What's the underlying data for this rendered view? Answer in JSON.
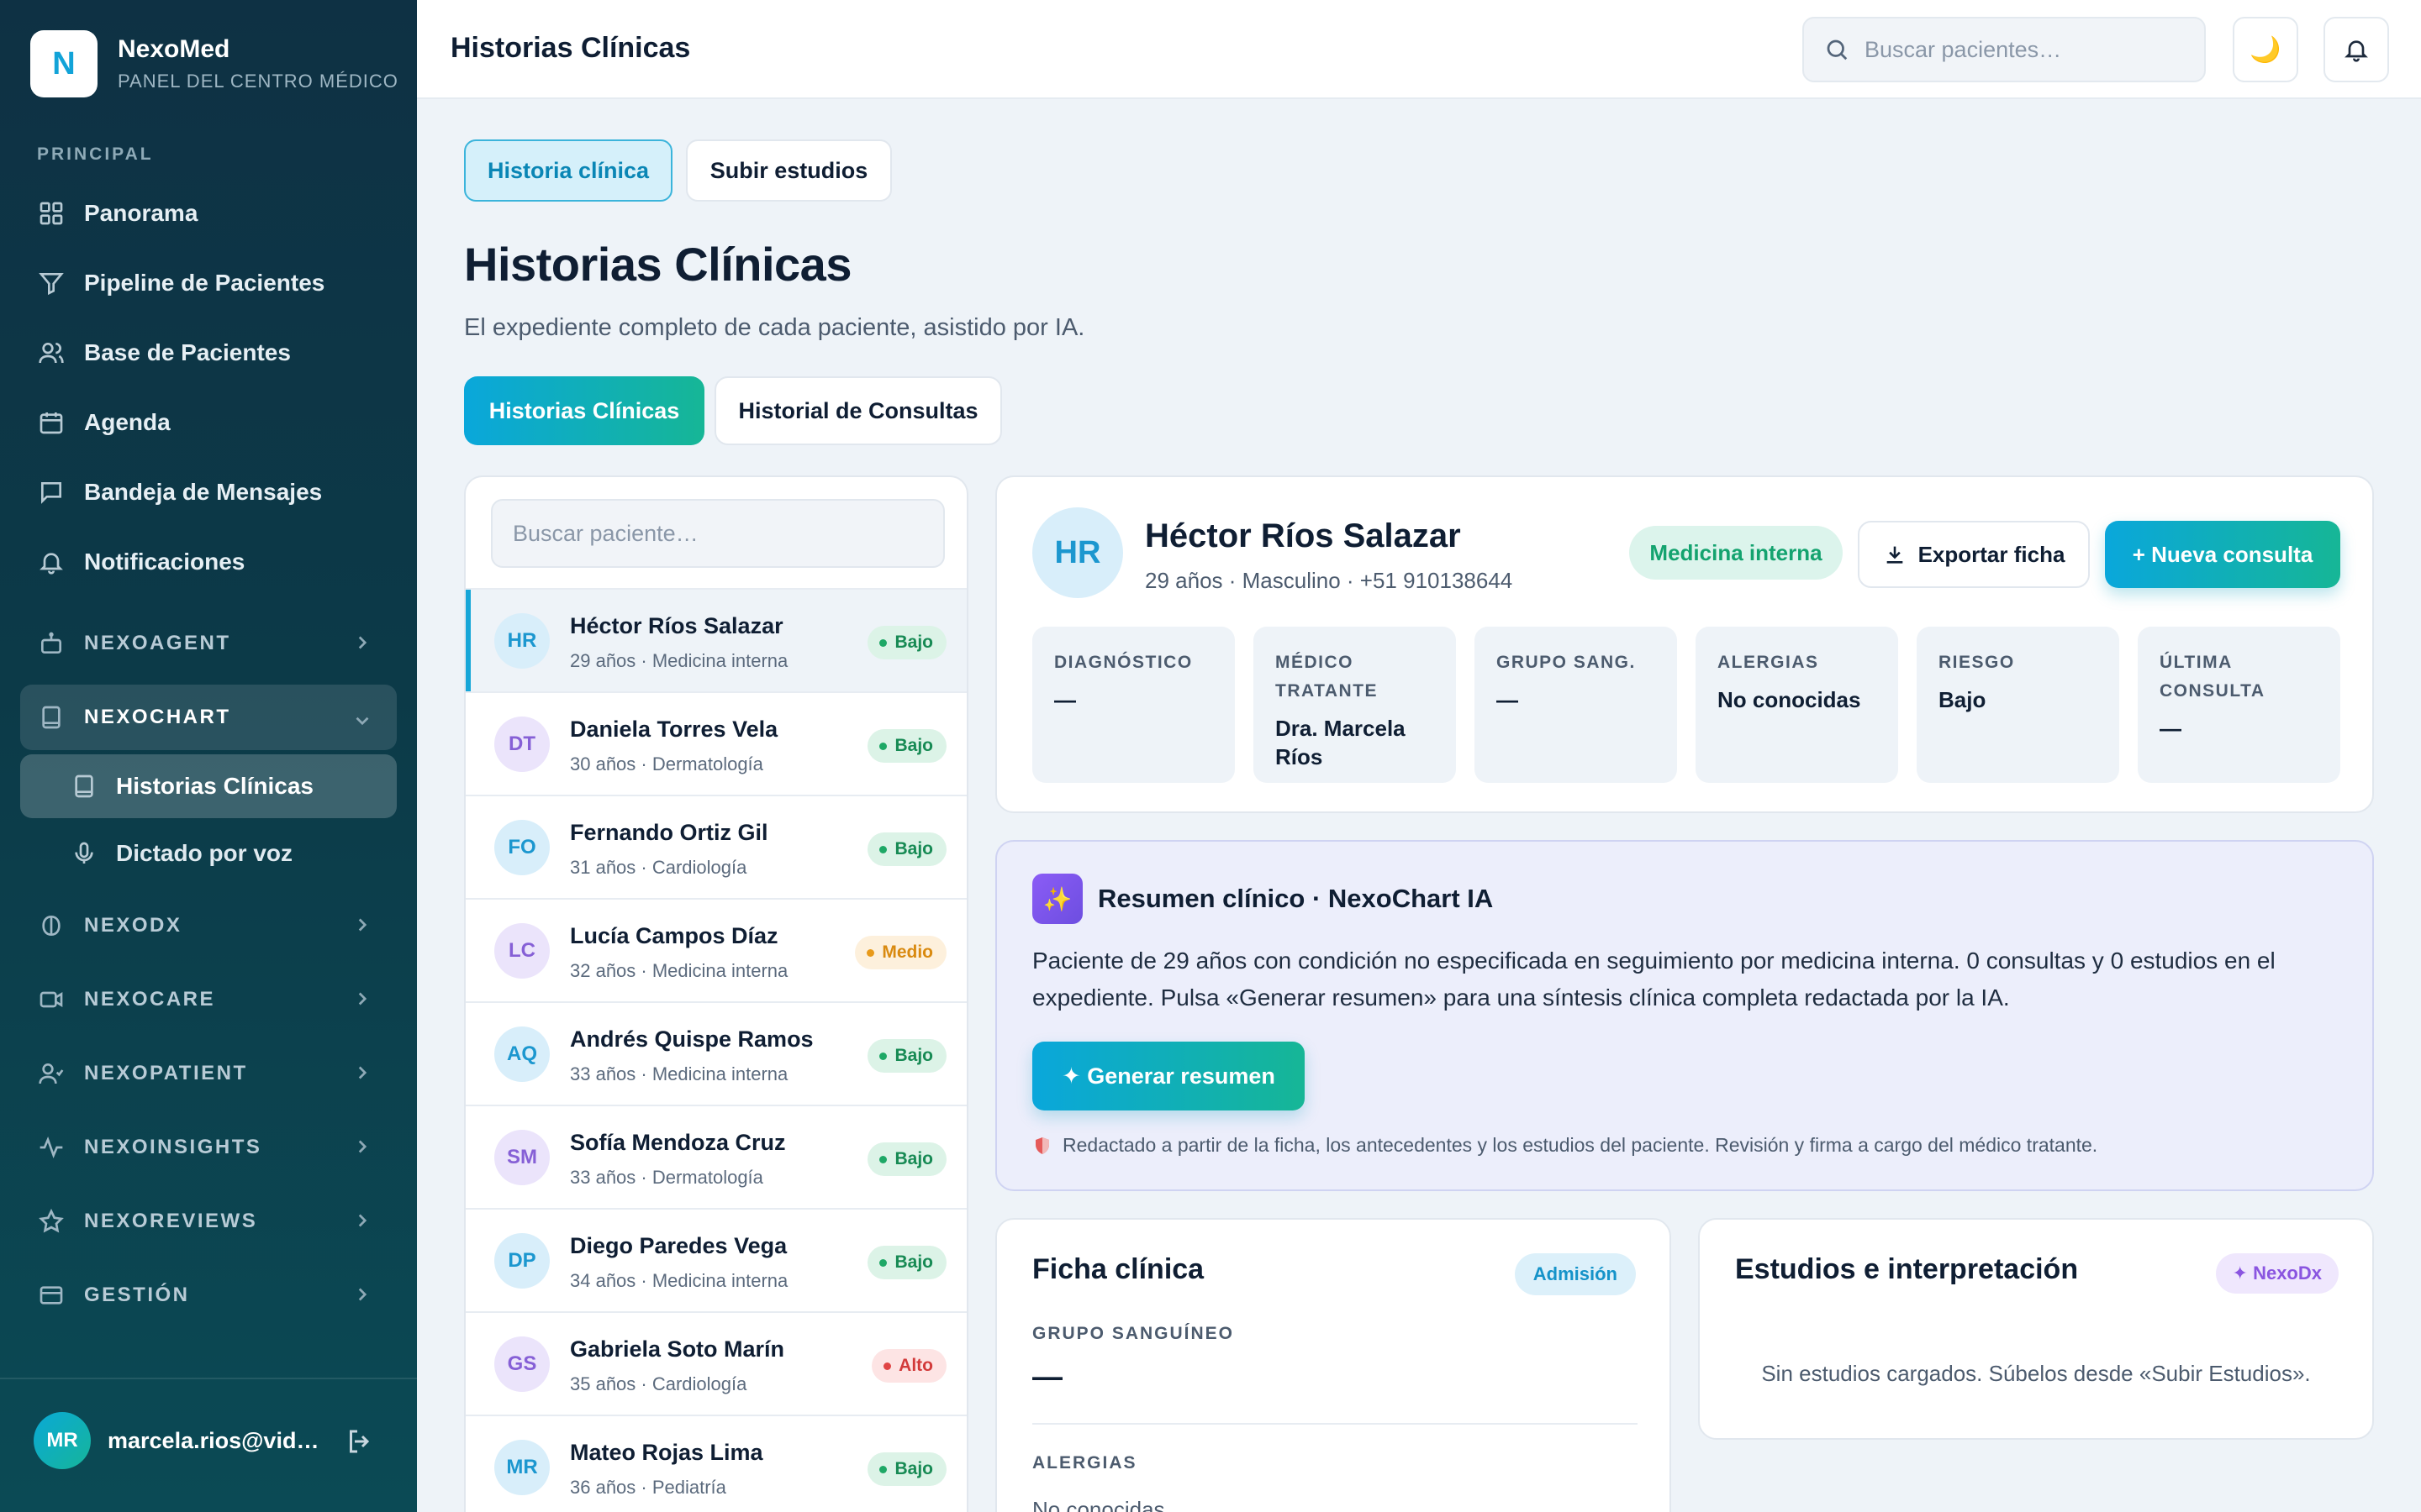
{
  "brand": {
    "logo_letter": "N",
    "name": "NexoMed",
    "subtitle": "PANEL DEL CENTRO MÉDICO"
  },
  "sidebar": {
    "section_label": "PRINCIPAL",
    "items": [
      {
        "label": "Panorama",
        "icon": "grid-icon"
      },
      {
        "label": "Pipeline de Pacientes",
        "icon": "filter-icon"
      },
      {
        "label": "Base de Pacientes",
        "icon": "users-icon"
      },
      {
        "label": "Agenda",
        "icon": "calendar-icon"
      },
      {
        "label": "Bandeja de Mensajes",
        "icon": "message-icon"
      },
      {
        "label": "Notificaciones",
        "icon": "bell-icon"
      }
    ],
    "groups": [
      {
        "label": "NEXOAGENT",
        "icon": "robot-icon"
      },
      {
        "label": "NEXOCHART",
        "icon": "book-icon"
      },
      {
        "label": "NEXODX",
        "icon": "brain-icon"
      },
      {
        "label": "NEXOCARE",
        "icon": "video-icon"
      },
      {
        "label": "NEXOPATIENT",
        "icon": "user-icon"
      },
      {
        "label": "NEXOINSIGHTS",
        "icon": "pulse-icon"
      },
      {
        "label": "NEXOREVIEWS",
        "icon": "star-icon"
      },
      {
        "label": "GESTIÓN",
        "icon": "card-icon"
      }
    ],
    "subitems": [
      {
        "label": "Historias Clínicas",
        "icon": "book-icon"
      },
      {
        "label": "Dictado por voz",
        "icon": "mic-icon"
      }
    ],
    "user": {
      "initials": "MR",
      "email": "marcela.rios@vidasalud.pe"
    }
  },
  "topbar": {
    "title": "Historias Clínicas",
    "search_placeholder": "Buscar pacientes…",
    "theme_icon": "🌙"
  },
  "main": {
    "pills": [
      "Historia clínica",
      "Subir estudios"
    ],
    "title": "Historias Clínicas",
    "subtitle": "El expediente completo de cada paciente, asistido por IA.",
    "tabs": [
      "Historias Clínicas",
      "Historial de Consultas"
    ]
  },
  "patient_list": {
    "search_placeholder": "Buscar paciente…",
    "patients": [
      {
        "initials": "HR",
        "name": "Héctor Ríos Salazar",
        "meta": "29 años · Medicina interna",
        "risk": "Bajo"
      },
      {
        "initials": "DT",
        "name": "Daniela Torres Vela",
        "meta": "30 años · Dermatología",
        "risk": "Bajo"
      },
      {
        "initials": "FO",
        "name": "Fernando Ortiz Gil",
        "meta": "31 años · Cardiología",
        "risk": "Bajo"
      },
      {
        "initials": "LC",
        "name": "Lucía Campos Díaz",
        "meta": "32 años · Medicina interna",
        "risk": "Medio"
      },
      {
        "initials": "AQ",
        "name": "Andrés Quispe Ramos",
        "meta": "33 años · Medicina interna",
        "risk": "Bajo"
      },
      {
        "initials": "SM",
        "name": "Sofía Mendoza Cruz",
        "meta": "33 años · Dermatología",
        "risk": "Bajo"
      },
      {
        "initials": "DP",
        "name": "Diego Paredes Vega",
        "meta": "34 años · Medicina interna",
        "risk": "Bajo"
      },
      {
        "initials": "GS",
        "name": "Gabriela Soto Marín",
        "meta": "35 años · Cardiología",
        "risk": "Alto"
      },
      {
        "initials": "MR",
        "name": "Mateo Rojas Lima",
        "meta": "36 años · Pediatría",
        "risk": "Bajo"
      }
    ]
  },
  "patient": {
    "initials": "HR",
    "name": "Héctor Ríos Salazar",
    "meta": "29 años · Masculino · +51 910138644",
    "specialty": "Medicina interna",
    "export_label": "Exportar ficha",
    "new_consult_label": "+ Nueva consulta",
    "stats": [
      {
        "label": "DIAGNÓSTICO",
        "value": "—"
      },
      {
        "label": "MÉDICO TRATANTE",
        "value": "Dra. Marcela Ríos"
      },
      {
        "label": "GRUPO SANG.",
        "value": "—"
      },
      {
        "label": "ALERGIAS",
        "value": "No conocidas"
      },
      {
        "label": "RIESGO",
        "value": "Bajo"
      },
      {
        "label": "ÚLTIMA CONSULTA",
        "value": "—"
      }
    ]
  },
  "ai_summary": {
    "icon": "✨",
    "title": "Resumen clínico · NexoChart IA",
    "text": "Paciente de 29 años con condición no especificada en seguimiento por medicina interna. 0 consultas y 0 estudios en el expediente. Pulsa «Generar resumen» para una síntesis clínica completa redactada por la IA.",
    "button": "✦ Generar resumen",
    "footnote": "Redactado a partir de la ficha, los antecedentes y los estudios del paciente. Revisión y firma a cargo del médico tratante."
  },
  "ficha": {
    "title": "Ficha clínica",
    "badge": "Admisión",
    "blood_label": "GRUPO SANGUÍNEO",
    "blood_value": "—",
    "allergy_label": "ALERGIAS",
    "allergy_value": "No conocidas"
  },
  "estudios": {
    "title": "Estudios e interpretación",
    "badge": "✦ NexoDx",
    "empty": "Sin estudios cargados. Súbelos desde «Subir Estudios»."
  },
  "colors": {
    "accent": "#0aa7db",
    "accent2": "#16b696",
    "sidebar": "#0c3a48",
    "risk_low": "#1ea866",
    "risk_mid": "#e89a1a",
    "risk_high": "#e04545"
  }
}
